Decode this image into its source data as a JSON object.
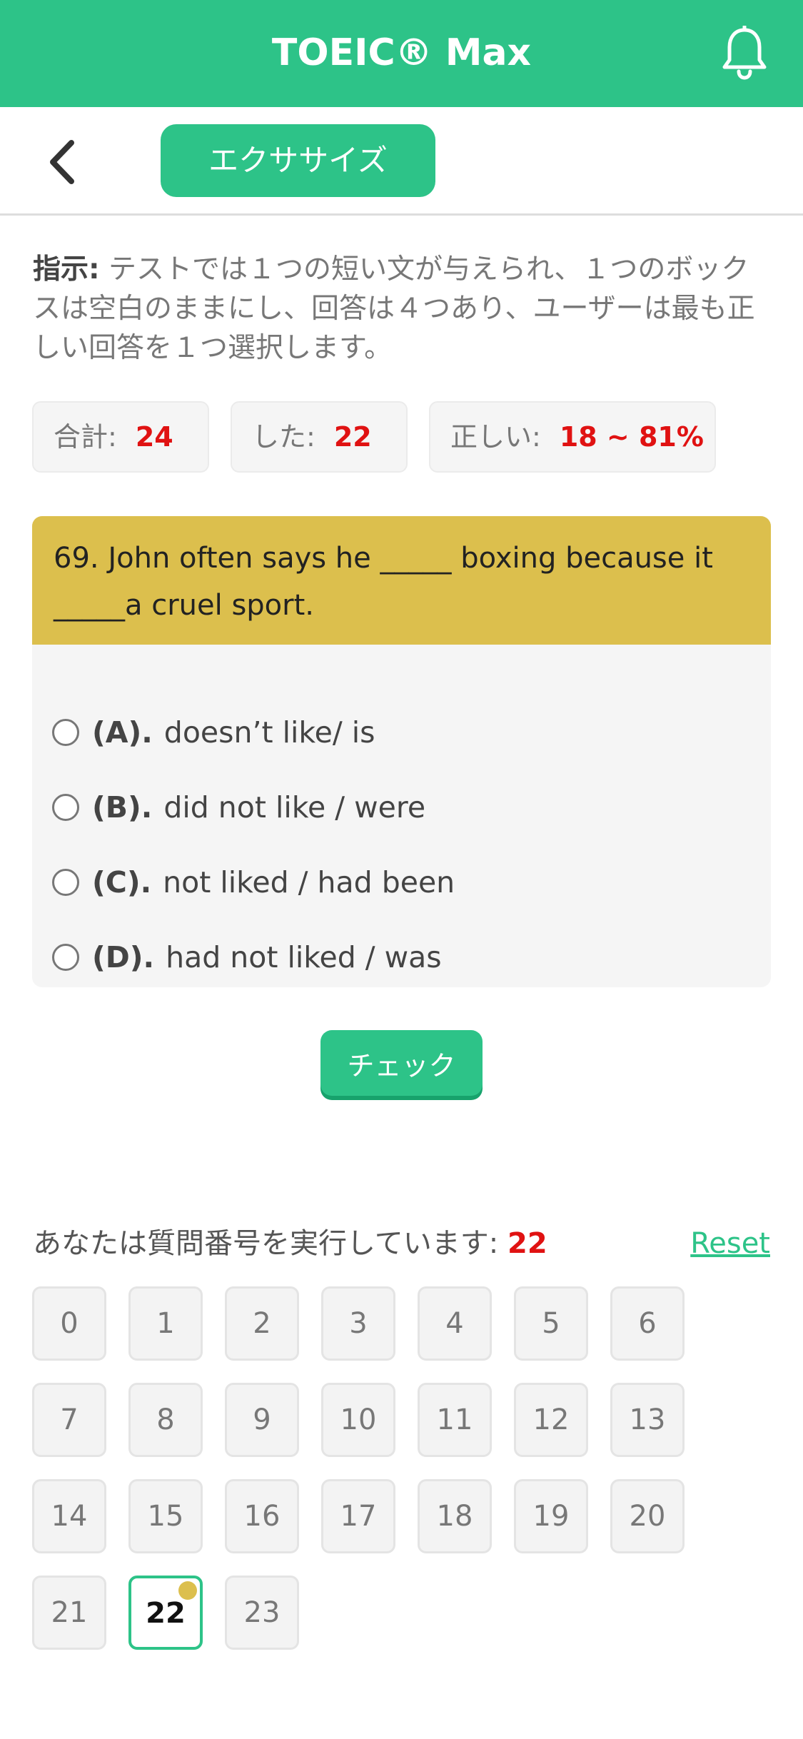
{
  "app": {
    "title": "TOEIC® Max"
  },
  "subbar": {
    "tab_label": "エクササイズ"
  },
  "instruction": {
    "label": "指示:",
    "text": " テストでは１つの短い文が与えられ、１つのボックスは空白のままにし、回答は４つあり、ユーザーは最も正しい回答を１つ選択します。"
  },
  "stats": [
    {
      "label": "合計:",
      "value": "24"
    },
    {
      "label": "した:",
      "value": "22"
    },
    {
      "label": "正しい:",
      "value": "18 ~ 81%"
    }
  ],
  "question": {
    "line1": "69. John often says he _____ boxing because it",
    "line2": "_____a cruel sport.",
    "options": [
      {
        "letter": "(A).",
        "text": "doesn’t like/ is"
      },
      {
        "letter": "(B).",
        "text": "did not like / were"
      },
      {
        "letter": "(C).",
        "text": "not liked / had been"
      },
      {
        "letter": "(D).",
        "text": "had not liked / was"
      }
    ]
  },
  "check_label": "チェック",
  "progress": {
    "label": "あなたは質問番号を実行しています:",
    "current": "22",
    "reset_label": "Reset"
  },
  "questions_grid": [
    "0",
    "1",
    "2",
    "3",
    "4",
    "5",
    "6",
    "7",
    "8",
    "9",
    "10",
    "11",
    "12",
    "13",
    "14",
    "15",
    "16",
    "17",
    "18",
    "19",
    "20",
    "21",
    "22",
    "23"
  ],
  "colors": {
    "brand": "#2dc388",
    "question_header": "#dcbf4d",
    "highlight": "#e01212"
  }
}
